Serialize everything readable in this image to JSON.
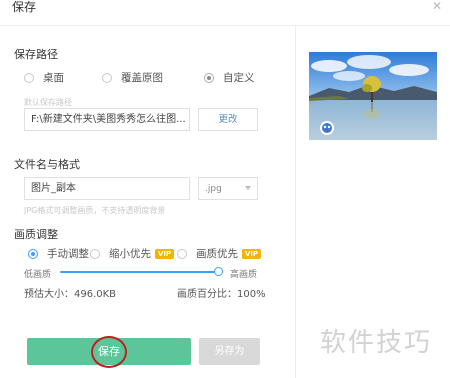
{
  "dialog": {
    "title": "保存"
  },
  "path_section": {
    "label": "保存路径",
    "options": [
      "桌面",
      "覆盖原图",
      "自定义"
    ],
    "selected": "自定义",
    "hint": "默认保存路径",
    "path_value": "F:\\新建文件夹\\美图秀秀怎么往图...",
    "change_button": "更改"
  },
  "name_section": {
    "label": "文件名与格式",
    "filename_value": "图片_副本",
    "format_value": ".jpg",
    "hint": "JPG格式可调整画质，不支持透明度背景"
  },
  "quality_section": {
    "label": "画质调整",
    "options": [
      {
        "label": "手动调整",
        "vip": ""
      },
      {
        "label": "缩小优先",
        "vip": "VIP"
      },
      {
        "label": "画质优先",
        "vip": "VIP"
      }
    ],
    "low_label": "低画质",
    "high_label": "高画质",
    "slider_value": 1.0,
    "estimate": "预估大小：496.0KB",
    "percent": "画质百分比：100%"
  },
  "buttons": {
    "save": "保存",
    "save_as": "另存为"
  },
  "watermark": "软件技巧",
  "colors": {
    "accent": "#3aa0ff",
    "save_green": "#5cc69a",
    "vip_gold": "#f5b400",
    "highlight_red": "#c21f1f"
  }
}
